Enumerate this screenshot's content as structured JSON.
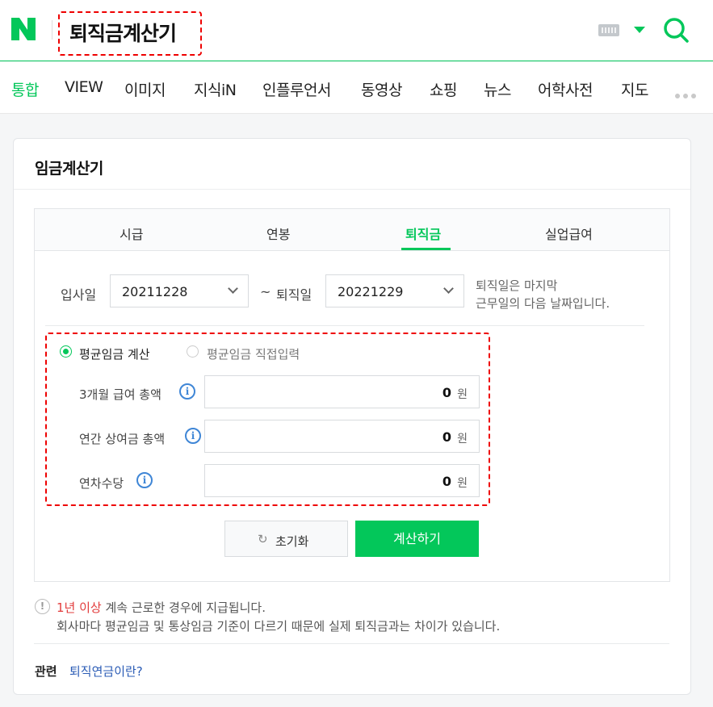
{
  "header": {
    "query": "퇴직금계산기",
    "brand_color": "#03c75a"
  },
  "nav": {
    "items": [
      "통합",
      "VIEW",
      "이미지",
      "지식iN",
      "인플루언서",
      "동영상",
      "쇼핑",
      "뉴스",
      "어학사전",
      "지도"
    ],
    "active": "통합"
  },
  "card": {
    "title": "임금계산기",
    "tabs": [
      "시급",
      "연봉",
      "퇴직금",
      "실업급여"
    ],
    "active_tab": "퇴직금",
    "start_label": "입사일",
    "start_value": "20211228",
    "tilde": "~",
    "end_label": "퇴직일",
    "end_value": "20221229",
    "note_line1": "퇴직일은 마지막",
    "note_line2": "근무일의 다음 날짜입니다.",
    "radio_avg_calc": "평균임금 계산",
    "radio_avg_direct": "평균임금 직접입력",
    "rows": [
      {
        "label": "3개월 급여 총액",
        "value": "0",
        "unit": "원"
      },
      {
        "label": "연간 상여금 총액",
        "value": "0",
        "unit": "원"
      },
      {
        "label": "연차수당",
        "value": "0",
        "unit": "원"
      }
    ],
    "info_glyph": "i",
    "reset_label": "초기화",
    "calc_label": "계산하기",
    "warn_highlight": "1년 이상",
    "warn_rest": " 계속 근로한 경우에 지급됩니다.",
    "warn_line2": "회사마다 평균임금 및 통상임금 기준이 다르기 때문에 실제 퇴직금과는 차이가 있습니다.",
    "related_label": "관련",
    "related_link": "퇴직연금이란?"
  }
}
